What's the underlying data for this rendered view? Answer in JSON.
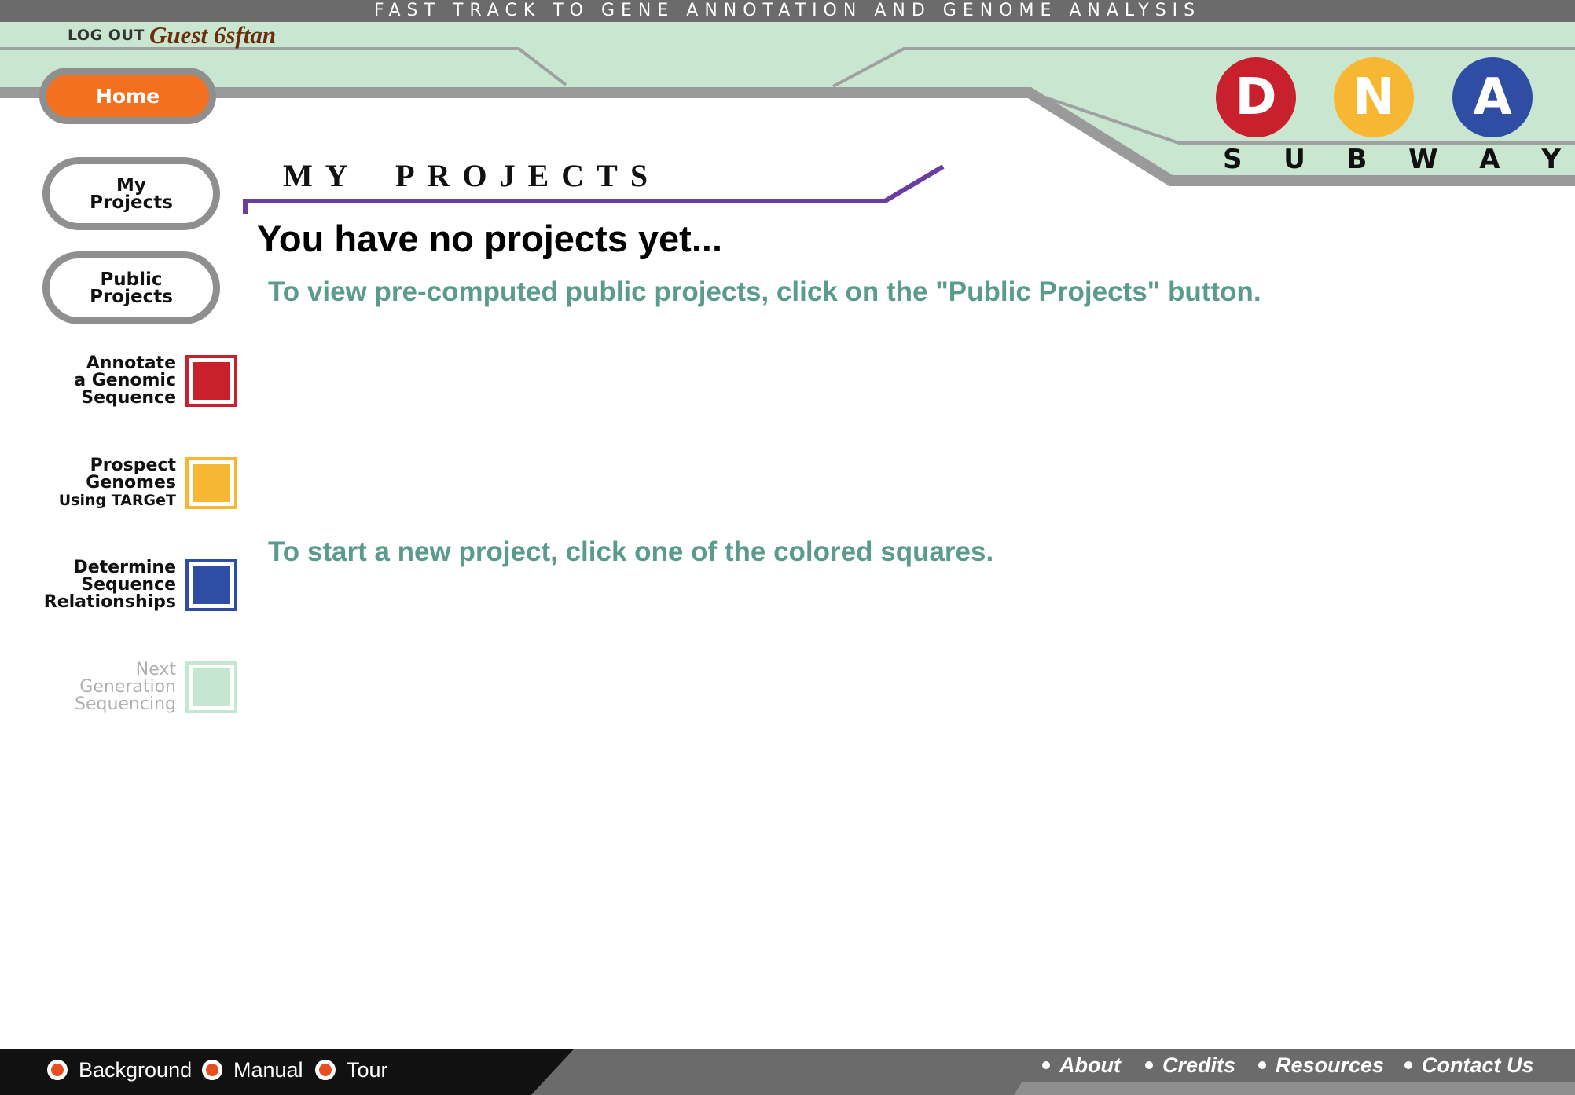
{
  "banner": {
    "tagline": "FAST TRACK TO GENE ANNOTATION AND GENOME ANALYSIS"
  },
  "session": {
    "logout_label": "LOG OUT",
    "user_name": "Guest 6sftan"
  },
  "nav": {
    "home_label": "Home",
    "my_projects_label": "My Projects",
    "public_projects_label": "Public Projects"
  },
  "logo": {
    "letters": [
      "D",
      "N",
      "A"
    ],
    "subtitle": [
      "S",
      "U",
      "B",
      "W",
      "A",
      "Y"
    ]
  },
  "tracks": [
    {
      "label_lines": [
        "Annotate",
        "a Genomic",
        "Sequence"
      ],
      "color": "#c8202d",
      "enabled": true
    },
    {
      "label_lines": [
        "Prospect",
        "Genomes",
        "Using TARGeT"
      ],
      "color": "#f7b733",
      "enabled": true
    },
    {
      "label_lines": [
        "Determine",
        "Sequence",
        "Relationships"
      ],
      "color": "#2e4da3",
      "enabled": true
    },
    {
      "label_lines": [
        "Next",
        "Generation",
        "Sequencing"
      ],
      "color": "#c5e6d0",
      "enabled": false
    }
  ],
  "main": {
    "section_title": "MY PROJECTS",
    "empty_heading": "You have no projects yet...",
    "public_hint": "To view pre-computed public projects, click on the \"Public Projects\" button.",
    "new_project_hint": "To start a new project, click one of the colored squares."
  },
  "footer": {
    "left_links": [
      "Background",
      "Manual",
      "Tour"
    ],
    "right_links": [
      "About",
      "Credits",
      "Resources",
      "Contact Us"
    ]
  },
  "colors": {
    "header_green": "#c8e6d0",
    "track_gray": "#8f8f8f",
    "home_orange": "#f3701f",
    "title_rule_purple": "#6a3ea1",
    "hint_teal": "#5b9b8e"
  }
}
